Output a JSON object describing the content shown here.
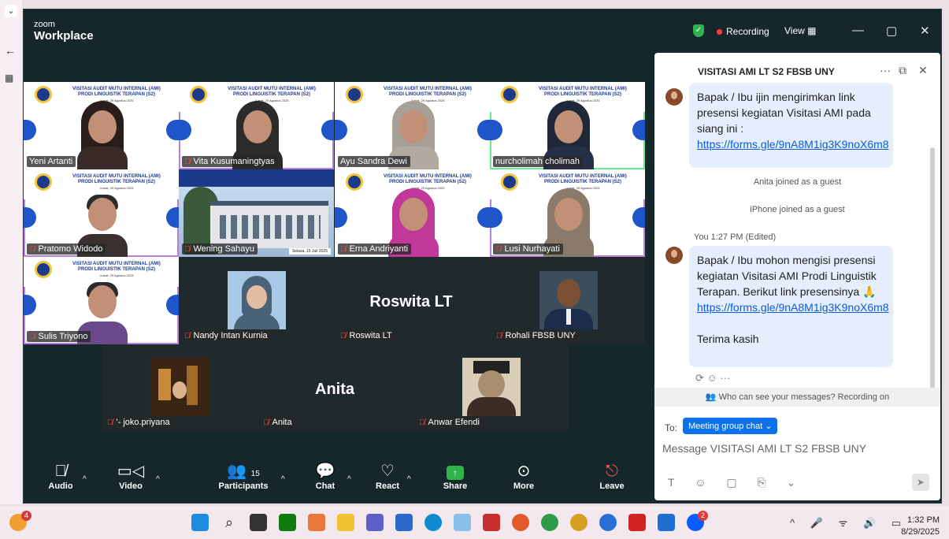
{
  "app": {
    "logo_top": "zoom",
    "logo_bottom": "Workplace"
  },
  "titlebar": {
    "recording": "Recording",
    "view": "View"
  },
  "banner": {
    "line1": "VISITASI AUDIT MUTU INTERNAL (AMI)",
    "line2": "PRODI LINGUISTIK TERAPAN (S2)",
    "date": "Jumat, 29 Agustus 2025"
  },
  "participants": [
    {
      "name": "Yeni Artanti",
      "muted": false
    },
    {
      "name": "Vita Kusumaningtyas",
      "muted": true
    },
    {
      "name": "Ayu Sandra Dewi",
      "muted": false
    },
    {
      "name": "nurcholimah cholimah",
      "muted": false
    },
    {
      "name": "Pratomo Widodo",
      "muted": true
    },
    {
      "name": "Wening Sahayu",
      "muted": true
    },
    {
      "name": "Erna Andriyanti",
      "muted": true
    },
    {
      "name": "Lusi Nurhayati",
      "muted": true
    },
    {
      "name": "Sulis Triyono",
      "muted": true
    },
    {
      "name": "Nandy Intan Kurnia",
      "muted": true
    },
    {
      "name": "Roswita LT",
      "muted": true
    },
    {
      "name": "Rohali FBSB UNY",
      "muted": true
    },
    {
      "name": "'- joko.priyana",
      "muted": true
    },
    {
      "name": "Anita",
      "muted": true
    },
    {
      "name": "Anwar Efendi",
      "muted": true
    }
  ],
  "center_names": {
    "roswita": "Roswita LT",
    "anita": "Anita"
  },
  "wening_slide": {
    "date": "Selasa, 15 Juli 2025"
  },
  "toolbar": {
    "audio": "Audio",
    "video": "Video",
    "participants": "Participants",
    "participants_count": "15",
    "chat": "Chat",
    "react": "React",
    "share": "Share",
    "more": "More",
    "leave": "Leave"
  },
  "chat": {
    "title": "VISITASI AMI LT S2 FBSB UNY",
    "msg1": "Bapak / Ibu ijin mengirimkan link presensi kegiatan Visitasi AMI pada siang ini :",
    "link1": "https://forms.gle/9nA8M1ig3K9noX6m8",
    "sys1": "Anita joined as a guest",
    "sys2": "iPhone joined as a guest",
    "meta2": "You 1:27 PM (Edited)",
    "msg2": "Bapak / Ibu mohon mengisi presensi kegiatan Visitasi AMI Prodi Linguistik Terapan. Berikut link presensinya 🙏",
    "link2": "https://forms.gle/9nA8M1ig3K9noX6m8",
    "msg2b": "Terima kasih",
    "who": "Who can see your messages? Recording on",
    "to_label": "To:",
    "to_value": "Meeting group chat ⌄",
    "placeholder": "Message VISITASI AMI LT S2 FBSB UNY"
  },
  "taskbar": {
    "time": "1:32 PM",
    "date": "8/29/2025",
    "badge1": "4",
    "badge2": "2"
  }
}
